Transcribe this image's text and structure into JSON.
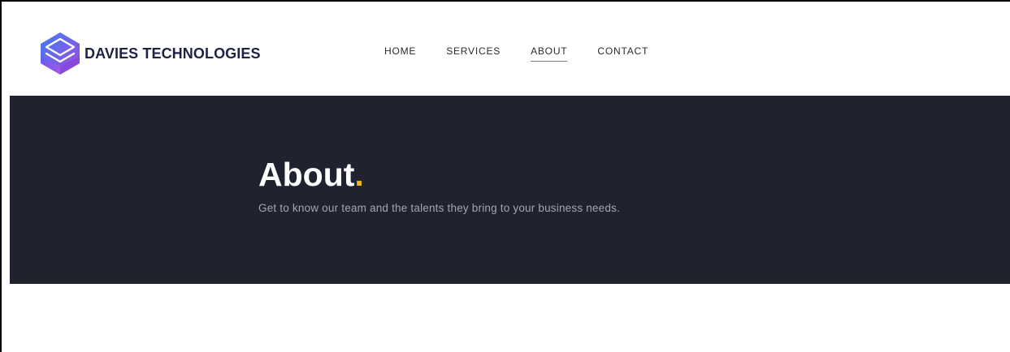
{
  "brand": {
    "name": "DAVIES TECHNOLOGIES",
    "logo_icon": "stacked-cube-logo-icon",
    "name_color": "#1f2145",
    "logo_gradient": [
      "#4a6cf7",
      "#9b4de0"
    ]
  },
  "nav": {
    "items": [
      {
        "label": "HOME"
      },
      {
        "label": "SERVICES"
      },
      {
        "label": "ABOUT"
      },
      {
        "label": "CONTACT"
      }
    ],
    "active": "ABOUT"
  },
  "hero": {
    "title": "About",
    "title_accent": ".",
    "subtitle": "Get to know our team and the talents they bring to your business needs.",
    "background_color": "#1f232f",
    "accent_color": "#f3b41c"
  }
}
